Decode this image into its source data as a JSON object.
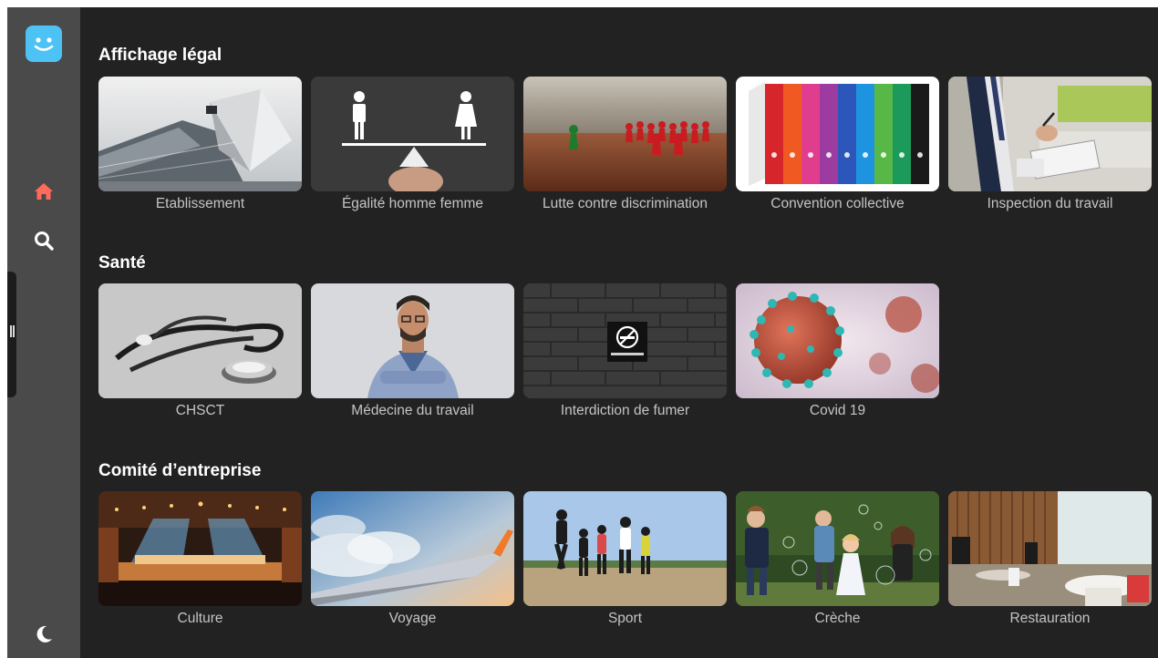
{
  "app": {
    "logo": "smiley-logo",
    "nav": [
      {
        "id": "home",
        "icon": "home-icon",
        "active": true,
        "color": "#ff6b5b"
      },
      {
        "id": "search",
        "icon": "search-icon",
        "active": false,
        "color": "#ffffff"
      }
    ],
    "theme_toggle_icon": "moon-icon",
    "accent_color": "#4dc3f5"
  },
  "sections": [
    {
      "title": "Affichage légal",
      "cards": [
        {
          "label": "Etablissement",
          "image": "modern-glass-building"
        },
        {
          "label": "Égalité homme femme",
          "image": "balance-man-woman"
        },
        {
          "label": "Lutte contre discrimination",
          "image": "green-pawn-vs-red-pawns"
        },
        {
          "label": "Convention collective",
          "image": "colored-binders"
        },
        {
          "label": "Inspection du travail",
          "image": "inspector-clipboard"
        }
      ]
    },
    {
      "title": "Santé",
      "cards": [
        {
          "label": "CHSCT",
          "image": "stethoscope"
        },
        {
          "label": "Médecine du travail",
          "image": "doctor-portrait"
        },
        {
          "label": "Interdiction de fumer",
          "image": "no-smoking-sign"
        },
        {
          "label": "Covid 19",
          "image": "coronavirus"
        }
      ]
    },
    {
      "title": "Comité d’entreprise",
      "cards": [
        {
          "label": "Culture",
          "image": "concert-hall"
        },
        {
          "label": "Voyage",
          "image": "airplane-wing"
        },
        {
          "label": "Sport",
          "image": "runners"
        },
        {
          "label": "Crèche",
          "image": "children-bubbles"
        },
        {
          "label": "Restauration",
          "image": "restaurant-interior"
        }
      ]
    }
  ]
}
